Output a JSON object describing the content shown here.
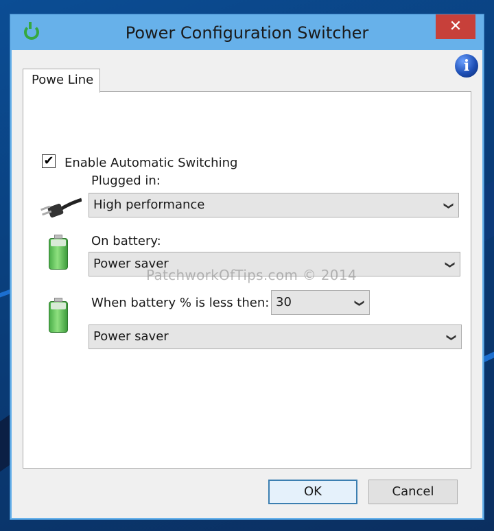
{
  "window": {
    "title": "Power Configuration Switcher",
    "close_symbol": "✕"
  },
  "tab": {
    "label": "Powe Line"
  },
  "info_icon": "i",
  "auto_switch": {
    "label": "Enable Automatic Switching",
    "checked": true,
    "mark": "✔"
  },
  "plugged_in": {
    "label": "Plugged in:",
    "value": "High performance"
  },
  "on_battery": {
    "label": "On battery:",
    "value": "Power saver"
  },
  "low_battery": {
    "label": "When battery % is less then:",
    "threshold": "30",
    "value": "Power saver"
  },
  "watermark": "PatchworkOfTips.com © 2014",
  "buttons": {
    "ok": "OK",
    "cancel": "Cancel"
  },
  "chevron": "❯"
}
